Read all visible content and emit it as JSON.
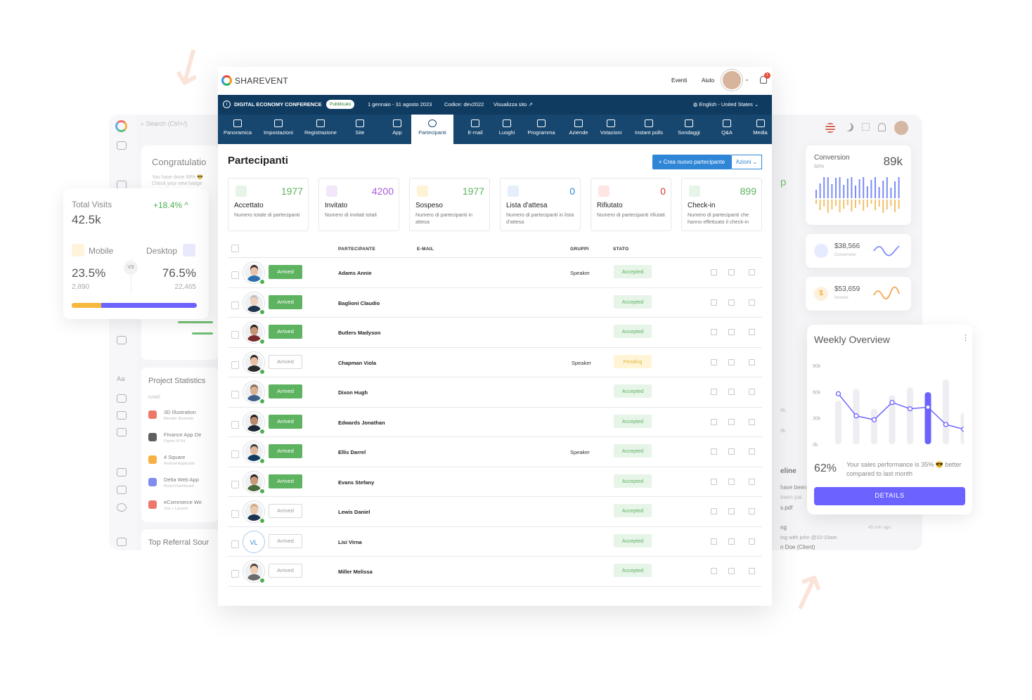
{
  "app": {
    "brand": "SHAREVENT",
    "top_links": [
      "Eventi",
      "Aiuto"
    ],
    "notification_count": "1"
  },
  "event_bar": {
    "name": "DIGITAL ECONOMY CONFERENCE",
    "status": "Pubblicato",
    "dates": "1 gennaio - 31 agosto 2023",
    "code": "Codice: dev2022",
    "view_site": "Visualizza sito",
    "language": "English - United States"
  },
  "nav": [
    {
      "label": "Panoramica",
      "icon": "dashboard-icon"
    },
    {
      "label": "Impostazioni",
      "icon": "sliders-icon"
    },
    {
      "label": "Registrazione",
      "icon": "ticket-icon"
    },
    {
      "label": "Site",
      "icon": "browser-icon"
    },
    {
      "label": "App",
      "icon": "mobile-icon"
    },
    {
      "label": "Partecipanti",
      "icon": "users-icon"
    },
    {
      "label": "E-mail",
      "icon": "email-icon"
    },
    {
      "label": "Luoghi",
      "icon": "map-pin-icon"
    },
    {
      "label": "Programma",
      "icon": "calendar-icon"
    },
    {
      "label": "Aziende",
      "icon": "building-icon"
    },
    {
      "label": "Votazioni",
      "icon": "vote-icon"
    },
    {
      "label": "Instant polls",
      "icon": "poll-icon"
    },
    {
      "label": "Sondaggi",
      "icon": "survey-icon"
    },
    {
      "label": "Q&A",
      "icon": "chat-icon"
    },
    {
      "label": "Media",
      "icon": "image-icon"
    }
  ],
  "page": {
    "title": "Partecipanti",
    "create_button": "+ Crea nuovo partecipante",
    "actions_button": "Azioni"
  },
  "stats": [
    {
      "value": "1977",
      "name": "Accettato",
      "desc": "Numero totale di partecipanti",
      "color": "#5db35f",
      "bg": "#e7f4e8"
    },
    {
      "value": "4200",
      "name": "Invitato",
      "desc": "Numero di invitati totali",
      "color": "#a95bd8",
      "bg": "#f2e6fa"
    },
    {
      "value": "1977",
      "name": "Sospeso",
      "desc": "Numero di partecipanti in attesa",
      "color": "#5db35f",
      "bg": "#fff3d6"
    },
    {
      "value": "0",
      "name": "Lista d'attesa",
      "desc": "Numero di partecipanti in lista d'attesa",
      "color": "#2f86d6",
      "bg": "#e6eefc"
    },
    {
      "value": "0",
      "name": "Rifiutato",
      "desc": "Numero di partecipanti rifiutati",
      "color": "#d9342b",
      "bg": "#fde6e4"
    },
    {
      "value": "899",
      "name": "Check-in",
      "desc": "Numero di partecipanti che hanno effettuato il check-in",
      "color": "#5db35f",
      "bg": "#e7f4e8"
    }
  ],
  "table": {
    "headers": {
      "participant": "PARTECIPANTE",
      "email": "E-MAIL",
      "groups": "GRUPPI",
      "status": "STATO"
    },
    "rows": [
      {
        "arrived": "Arrived",
        "arrived_on": true,
        "name": "Adams Annie",
        "group": "Speaker",
        "status": "Accepted"
      },
      {
        "arrived": "Arrived",
        "arrived_on": true,
        "name": "Baglioni Claudio",
        "group": "",
        "status": "Accepted"
      },
      {
        "arrived": "Arrived",
        "arrived_on": true,
        "name": "Butlers Madyson",
        "group": "",
        "status": "Accepted"
      },
      {
        "arrived": "Arrived",
        "arrived_on": false,
        "name": "Chapman Viola",
        "group": "Speaker",
        "status": "Pending"
      },
      {
        "arrived": "Arrived",
        "arrived_on": true,
        "name": "Dixon Hugh",
        "group": "",
        "status": "Accepted"
      },
      {
        "arrived": "Arrived",
        "arrived_on": true,
        "name": "Edwards Jonathan",
        "group": "",
        "status": "Accepted"
      },
      {
        "arrived": "Arrived",
        "arrived_on": true,
        "name": "Ellis Darrel",
        "group": "Speaker",
        "status": "Accepted"
      },
      {
        "arrived": "Arrived",
        "arrived_on": true,
        "name": "Evans Stefany",
        "group": "",
        "status": "Accepted"
      },
      {
        "arrived": "Arrived",
        "arrived_on": false,
        "name": "Lewis Daniel",
        "group": "",
        "status": "Accepted"
      },
      {
        "arrived": "Arrived",
        "arrived_on": false,
        "name": "Lisi Virna",
        "group": "",
        "status": "Accepted",
        "initials": "VL"
      },
      {
        "arrived": "Arrived",
        "arrived_on": false,
        "name": "Miller Melissa",
        "group": "",
        "status": "Accepted"
      }
    ]
  },
  "visits_card": {
    "title": "Total Visits",
    "change": "+18.4%",
    "total": "42.5k",
    "mobile_label": "Mobile",
    "desktop_label": "Desktop",
    "vs": "VS",
    "mobile_pct": "23.5%",
    "mobile_count": "2,890",
    "desktop_pct": "76.5%",
    "desktop_count": "22,465",
    "mobile_share": 0.235
  },
  "bg_dashboard": {
    "search_placeholder": "Search (Ctrl+/)",
    "congrats": "Congratulatio",
    "congrats_line1": "You have done 68% 😎",
    "congrats_line2": "Check your new badge",
    "project_stats_title": "Project Statistics",
    "name_col": "NAME",
    "projects": [
      {
        "name": "3D Illustration",
        "sub": "Blender Illustratio",
        "color": "#e8533f"
      },
      {
        "name": "Finance App De",
        "sub": "Figma UI Kit",
        "color": "#333333"
      },
      {
        "name": "4 Square",
        "sub": "Android Applicatio",
        "color": "#f39c12"
      },
      {
        "name": "Delta Web App",
        "sub": "React Dashboard",
        "color": "#5b6ee8"
      },
      {
        "name": "eCommerce We",
        "sub": "Vue + Laravel",
        "color": "#e8533f"
      }
    ],
    "referral_title": "Top Referral Sour",
    "timeline_title": "eline",
    "timeline_line1": "have been",
    "timeline_line2": "been pai",
    "timeline_file": "s.pdf",
    "meeting_label": "ng",
    "meeting_time": "45 min ago",
    "meeting_line": "ing with john @10:15am",
    "meeting_client": "n Doe (Client)",
    "side_6k": "6k",
    "side_9k": "9k",
    "side_p": "p"
  },
  "conversion_card": {
    "title": "Conversion",
    "value": "89k",
    "sub": "60%"
  },
  "revenue_card": {
    "amount": "$38,566",
    "label": "Conversion"
  },
  "income_card": {
    "amount": "$53,659",
    "label": "Income"
  },
  "weekly": {
    "title": "Weekly Overview",
    "y_ticks": [
      "90k",
      "60k",
      "30k",
      "0k"
    ],
    "bars": [
      55,
      70,
      45,
      62,
      72,
      66,
      82,
      40
    ],
    "line": [
      64,
      36,
      31,
      53,
      45,
      47,
      25,
      19
    ],
    "percent": "62%",
    "text": "Your sales performance is 35% 😎 better compared to last month",
    "button": "DETAILS",
    "accent": "#6c63ff"
  }
}
